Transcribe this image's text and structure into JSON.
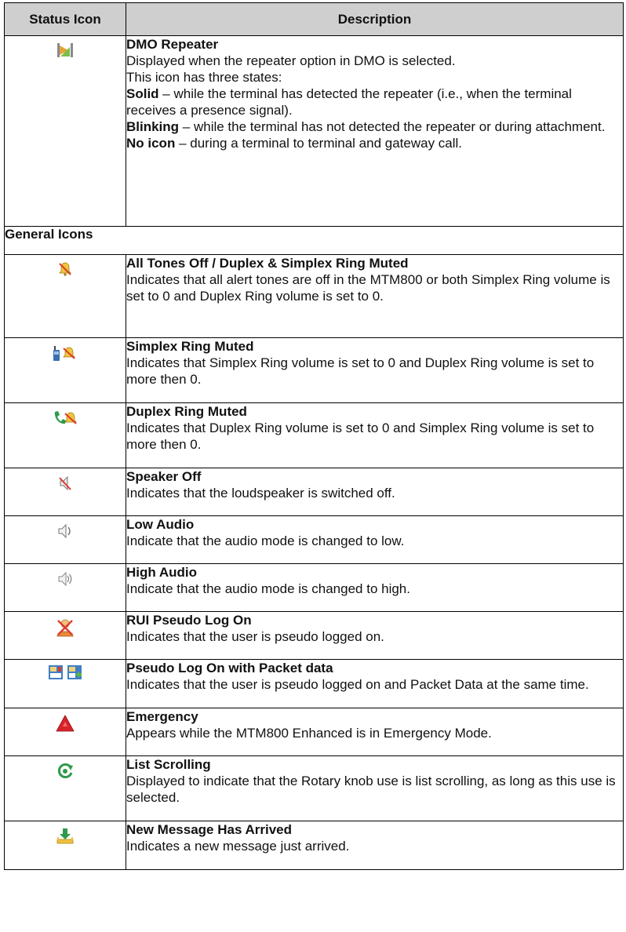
{
  "table": {
    "headers": {
      "icon": "Status Icon",
      "description": "Description"
    },
    "dmo": {
      "icon": "dmo-repeater-icon",
      "title": "DMO Repeater",
      "line1": "Displayed when the repeater option in DMO is selected.",
      "line2": "This icon has three states:",
      "solid_label": "Solid",
      "solid_text": " – while the terminal has detected the repeater (i.e., when the terminal receives a presence signal).",
      "blinking_label": "Blinking",
      "blinking_text": " – while the terminal has not detected the repeater or during attachment.",
      "noicon_label": "No icon",
      "noicon_text": " – during a terminal to terminal and gateway call."
    },
    "section_title": "General Icons",
    "rows": [
      {
        "icon": "all-tones-off-icon",
        "title": "All Tones Off / Duplex & Simplex Ring Muted",
        "text": "Indicates that all alert tones are off in the MTM800 or both Simplex Ring volume is set to 0 and Duplex Ring volume is set to 0."
      },
      {
        "icon": "simplex-ring-muted-icon",
        "title": "Simplex Ring Muted",
        "text": "Indicates that Simplex Ring volume is set to 0 and Duplex Ring volume is set to more then 0."
      },
      {
        "icon": "duplex-ring-muted-icon",
        "title": "Duplex Ring Muted",
        "text": "Indicates that Duplex Ring volume is set to 0 and Simplex Ring volume is set to more then 0."
      },
      {
        "icon": "speaker-off-icon",
        "title": "Speaker Off",
        "text": "Indicates that the loudspeaker is switched off."
      },
      {
        "icon": "low-audio-icon",
        "title": "Low Audio",
        "text": "Indicate that the audio mode is changed to low."
      },
      {
        "icon": "high-audio-icon",
        "title": "High Audio",
        "text": "Indicate that the audio mode is changed to high."
      },
      {
        "icon": "rui-pseudo-log-on-icon",
        "title": "RUI Pseudo Log On",
        "text": "Indicates that the user is pseudo logged on."
      },
      {
        "icon": "pseudo-log-on-packet-data-icon",
        "title": "Pseudo Log On with Packet data",
        "text": "Indicates that the user is pseudo logged on and Packet Data at the same time."
      },
      {
        "icon": "emergency-icon",
        "title": "Emergency",
        "text": "Appears while the MTM800 Enhanced is in Emergency Mode."
      },
      {
        "icon": "list-scrolling-icon",
        "title": "List Scrolling",
        "text": "Displayed to indicate that the Rotary knob use is list scrolling, as long as this use is selected."
      },
      {
        "icon": "new-message-icon",
        "title": "New Message Has Arrived",
        "text": "Indicates a new message just arrived."
      }
    ]
  }
}
